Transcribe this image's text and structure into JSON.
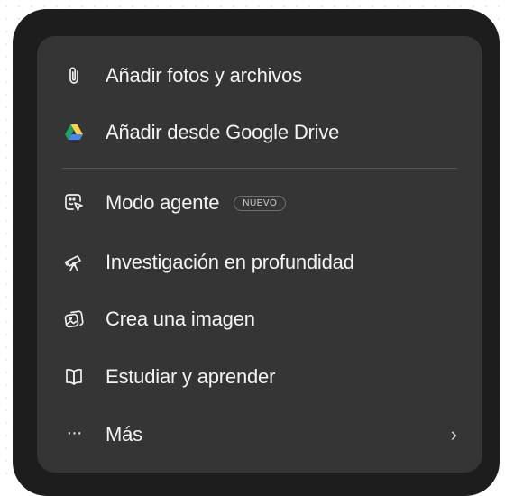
{
  "menu": {
    "items": [
      {
        "label": "Añadir fotos y archivos",
        "icon": "paperclip-icon"
      },
      {
        "label": "Añadir desde Google Drive",
        "icon": "google-drive-icon"
      },
      {
        "label": "Modo agente",
        "icon": "agent-cursor-icon",
        "badge": "NUEVO"
      },
      {
        "label": "Investigación en profundidad",
        "icon": "telescope-icon"
      },
      {
        "label": "Crea una imagen",
        "icon": "image-icon"
      },
      {
        "label": "Estudiar y aprender",
        "icon": "book-icon"
      },
      {
        "label": "Más",
        "icon": "more-dots-icon",
        "chevron": "chevron-right-icon"
      }
    ]
  },
  "colors": {
    "frame": "#1d1d1d",
    "menu_bg": "#353535",
    "text": "#f3f3f3",
    "drive_green": "#1fa463",
    "drive_yellow": "#ffd04b",
    "drive_blue": "#4687f4"
  }
}
